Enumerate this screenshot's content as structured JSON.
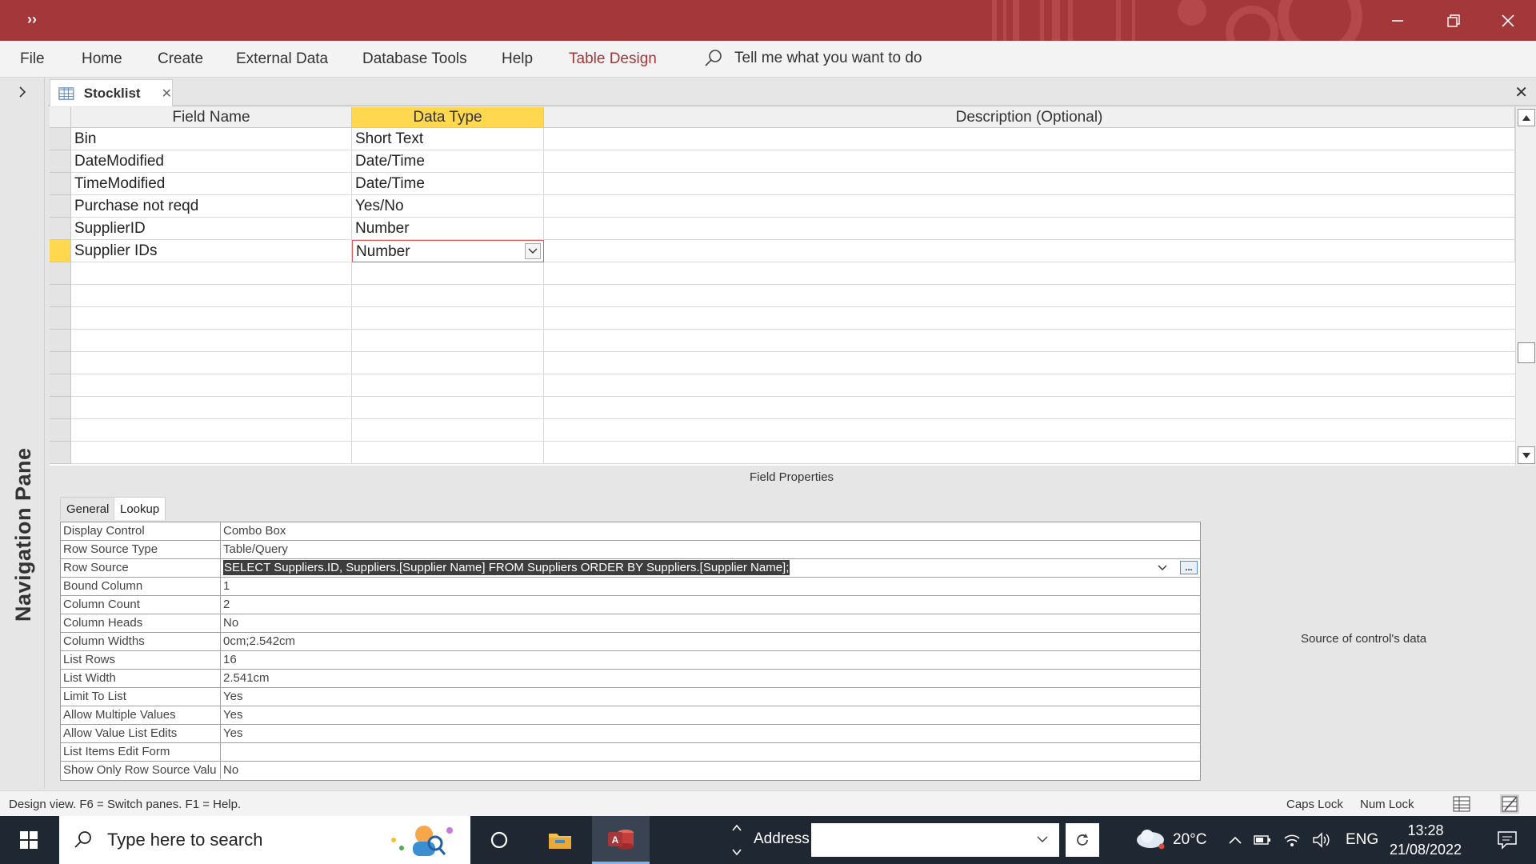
{
  "window": {
    "qat_label": "››",
    "colors": {
      "accent": "#a4373a",
      "highlight": "#ffd84f"
    }
  },
  "ribbon": {
    "tabs": [
      "File",
      "Home",
      "Create",
      "External Data",
      "Database Tools",
      "Help",
      "Table Design"
    ],
    "active_tab": "Table Design",
    "tell_me": "Tell me what you want to do"
  },
  "navigation_pane": {
    "label": "Navigation Pane"
  },
  "document_tab": {
    "label": "Stocklist"
  },
  "design_grid": {
    "headers": [
      "Field Name",
      "Data Type",
      "Description (Optional)"
    ],
    "rows": [
      {
        "field": "Bin",
        "type": "Short Text",
        "description": ""
      },
      {
        "field": "DateModified",
        "type": "Date/Time",
        "description": ""
      },
      {
        "field": "TimeModified",
        "type": "Date/Time",
        "description": ""
      },
      {
        "field": "Purchase not reqd",
        "type": "Yes/No",
        "description": ""
      },
      {
        "field": "SupplierID",
        "type": "Number",
        "description": ""
      },
      {
        "field": "Supplier IDs",
        "type": "Number",
        "description": ""
      }
    ],
    "current_row": 6
  },
  "field_properties": {
    "caption": "Field Properties",
    "tabs": [
      "General",
      "Lookup"
    ],
    "active_tab": "Lookup",
    "rows": [
      {
        "label": "Display Control",
        "value": "Combo Box"
      },
      {
        "label": "Row Source Type",
        "value": "Table/Query"
      },
      {
        "label": "Row Source",
        "value": "SELECT Suppliers.ID, Suppliers.[Supplier Name] FROM Suppliers ORDER BY Suppliers.[Supplier Name];"
      },
      {
        "label": "Bound Column",
        "value": "1"
      },
      {
        "label": "Column Count",
        "value": "2"
      },
      {
        "label": "Column Heads",
        "value": "No"
      },
      {
        "label": "Column Widths",
        "value": "0cm;2.542cm"
      },
      {
        "label": "List Rows",
        "value": "16"
      },
      {
        "label": "List Width",
        "value": "2.541cm"
      },
      {
        "label": "Limit To List",
        "value": "Yes"
      },
      {
        "label": "Allow Multiple Values",
        "value": "Yes"
      },
      {
        "label": "Allow Value List Edits",
        "value": "Yes"
      },
      {
        "label": "List Items Edit Form",
        "value": ""
      },
      {
        "label": "Show Only Row Source Valu",
        "value": "No"
      }
    ],
    "build_button": "...",
    "hint": "Source of control's data"
  },
  "status_bar": {
    "message": "Design view.  F6 = Switch panes.  F1 = Help.",
    "caps_lock": "Caps Lock",
    "num_lock": "Num Lock"
  },
  "taskbar": {
    "search_placeholder": "Type here to search",
    "address_label": "Address",
    "weather": "20°C",
    "language": "ENG",
    "time": "13:28",
    "date": "21/08/2022",
    "app_badge": "A"
  }
}
